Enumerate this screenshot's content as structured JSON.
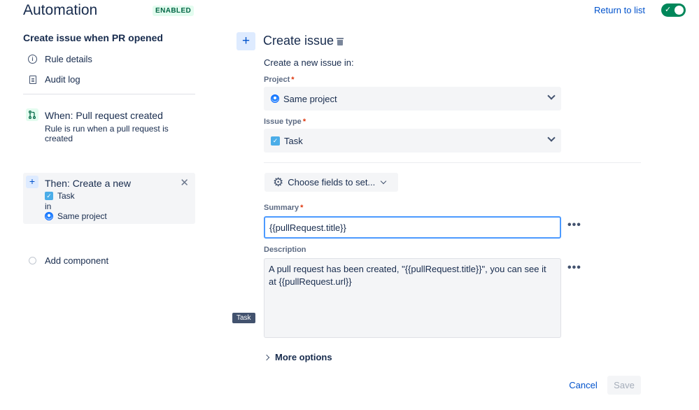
{
  "header": {
    "title": "Automation",
    "status_badge": "ENABLED",
    "return_link": "Return to list",
    "toggle_on": true
  },
  "sidebar": {
    "rule_name": "Create issue when PR opened",
    "nav": [
      {
        "label": "Rule details",
        "icon": "info-icon"
      },
      {
        "label": "Audit log",
        "icon": "document-icon"
      }
    ],
    "trigger": {
      "title": "When: Pull request created",
      "description": "Rule is run when a pull request is created",
      "icon": "pull-request-icon"
    },
    "action": {
      "title": "Then: Create a new",
      "issue_type": "Task",
      "connector": "in",
      "project": "Same project"
    },
    "add_component": "Add component"
  },
  "editor": {
    "title": "Create issue",
    "intro": "Create a new issue in:",
    "project": {
      "label": "Project",
      "value": "Same project"
    },
    "issue_type": {
      "label": "Issue type",
      "value": "Task"
    },
    "choose_fields": "Choose fields to set...",
    "summary": {
      "label": "Summary",
      "value": "{{pullRequest.title}}"
    },
    "description": {
      "label": "Description",
      "value": "A pull request has been created, \"{{pullRequest.title}}\", you can see it at {{pullRequest.url}}"
    },
    "tooltip": "Task",
    "more_options": "More options",
    "more_dots": "•••",
    "cancel": "Cancel",
    "save": "Save"
  },
  "colors": {
    "accent": "#0052cc",
    "enabled_green": "#00875a",
    "focus_border": "#4c9aff"
  }
}
